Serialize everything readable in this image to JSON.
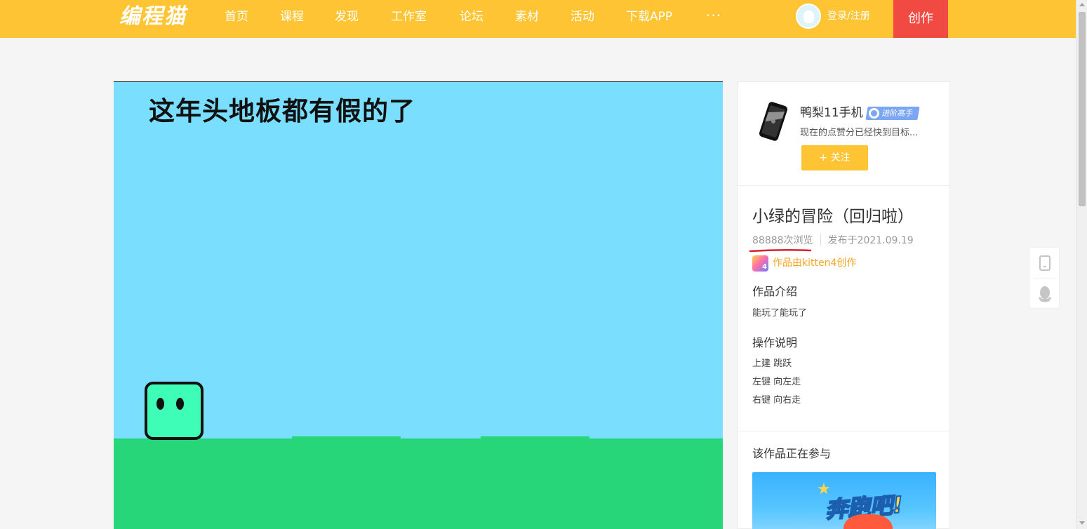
{
  "header": {
    "logo": "编程猫",
    "nav": [
      "首页",
      "课程",
      "发现",
      "工作室",
      "论坛",
      "素材",
      "活动",
      "下载APP"
    ],
    "more": "···",
    "login": "登录/注册",
    "create": "创作"
  },
  "stage": {
    "title": "这年头地板都有假的了"
  },
  "author": {
    "name": "鸭梨11手机",
    "badge": "进阶高手",
    "desc": "现在的点赞分已经快到目标...",
    "follow": "+ 关注"
  },
  "work": {
    "title": "小绿的冒险（回归啦）",
    "views": "88888次浏览",
    "published": "发布于2021.09.19",
    "made_with": "作品由kitten4创作",
    "intro_heading": "作品介绍",
    "intro_text": "能玩了能玩了",
    "controls_heading": "操作说明",
    "controls": [
      "上建 跳跃",
      "左键 向左走",
      "右键 向右走"
    ],
    "participating_heading": "该作品正在参与"
  },
  "banner": {
    "text": "奔跑吧!"
  },
  "colors": {
    "brand_yellow": "#fec433",
    "create_red": "#f04a43",
    "sky": "#7adefe",
    "ground": "#26d678",
    "hero": "#3efdb7",
    "badge_blue": "#7ba6f4"
  }
}
